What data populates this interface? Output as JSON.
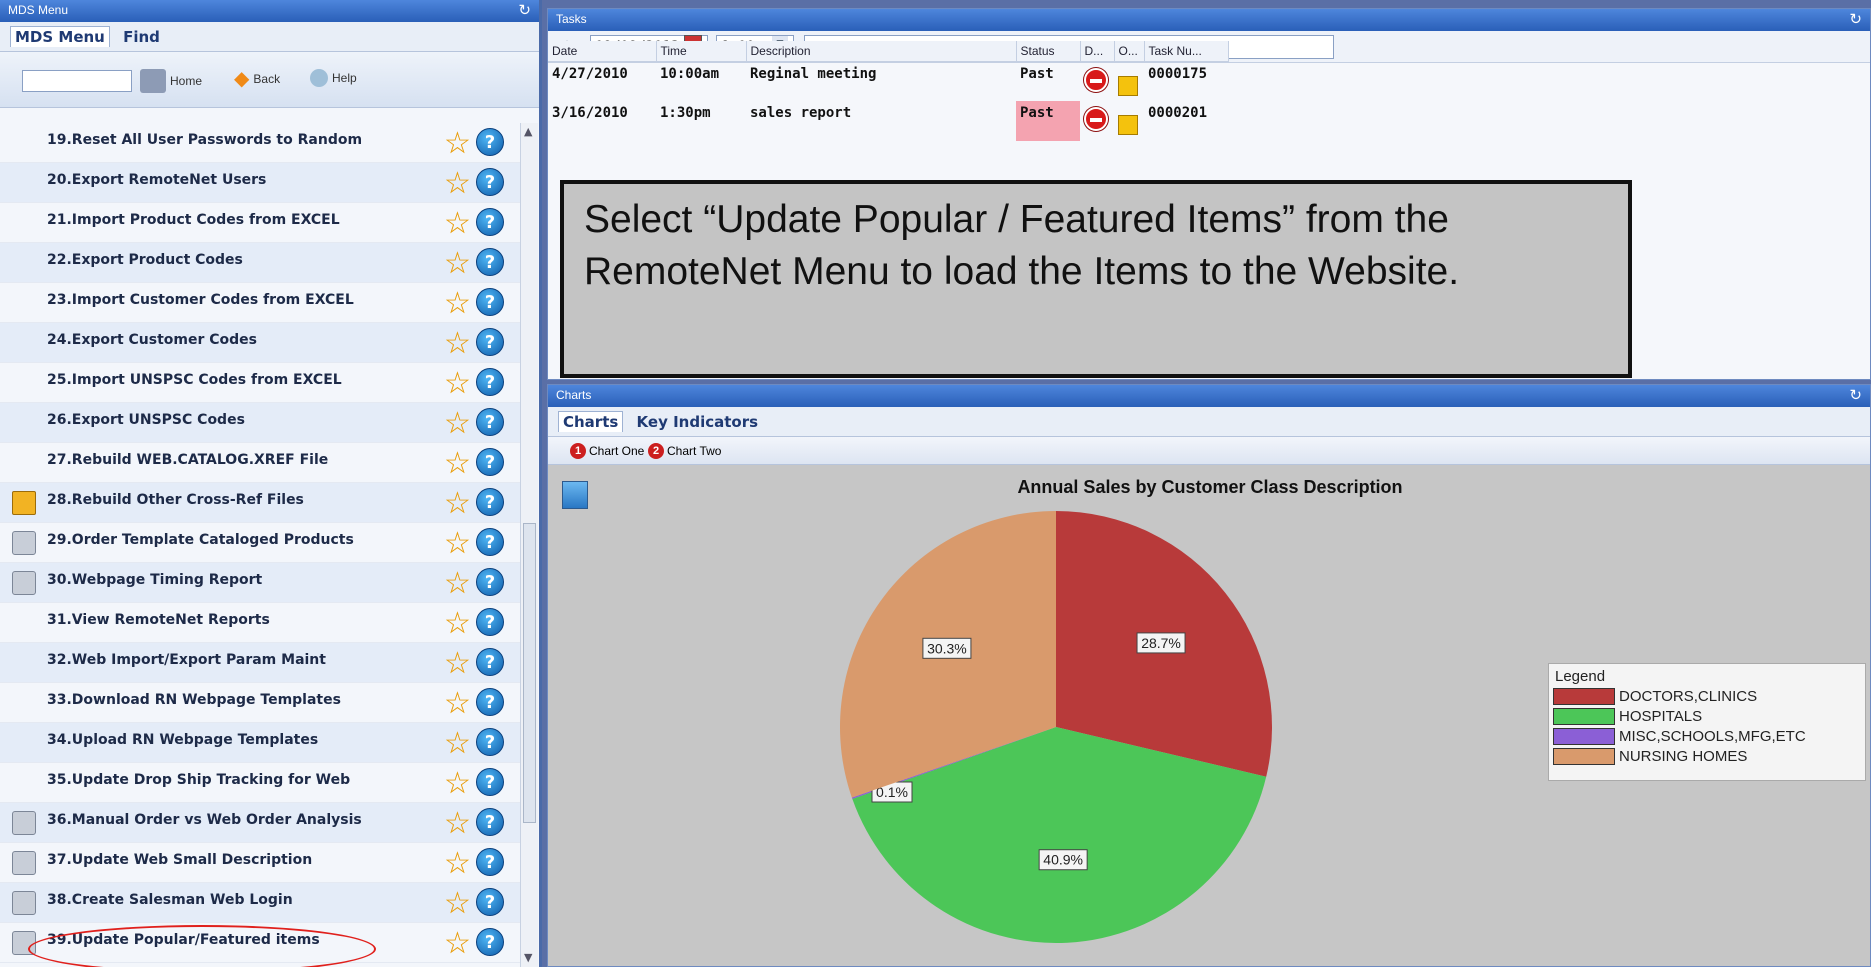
{
  "left_panel": {
    "title": "MDS Menu",
    "tabs": [
      "MDS Menu",
      "Find"
    ],
    "toolbar": {
      "home": "Home",
      "back": "Back",
      "help": "Help"
    },
    "items": [
      {
        "label": "19.Reset All User Passwords to Random",
        "icon": ""
      },
      {
        "label": "20.Export RemoteNet Users",
        "icon": ""
      },
      {
        "label": "21.Import Product Codes from EXCEL",
        "icon": ""
      },
      {
        "label": "22.Export Product Codes",
        "icon": ""
      },
      {
        "label": "23.Import Customer Codes from EXCEL",
        "icon": ""
      },
      {
        "label": "24.Export Customer Codes",
        "icon": ""
      },
      {
        "label": "25.Import UNSPSC Codes from EXCEL",
        "icon": ""
      },
      {
        "label": "26.Export UNSPSC Codes",
        "icon": ""
      },
      {
        "label": "27.Rebuild WEB.CATALOG.XREF File",
        "icon": ""
      },
      {
        "label": "28.Rebuild Other Cross-Ref Files",
        "icon": "folder-icon"
      },
      {
        "label": "29.Order Template Cataloged Products",
        "icon": "printer-icon"
      },
      {
        "label": "30.Webpage Timing Report",
        "icon": "printer-icon"
      },
      {
        "label": "31.View RemoteNet Reports",
        "icon": ""
      },
      {
        "label": "32.Web Import/Export Param Maint",
        "icon": ""
      },
      {
        "label": "33.Download RN Webpage Templates",
        "icon": ""
      },
      {
        "label": "34.Upload RN Webpage Templates",
        "icon": ""
      },
      {
        "label": "35.Update Drop Ship Tracking for Web",
        "icon": ""
      },
      {
        "label": "36.Manual Order vs Web Order Analysis",
        "icon": "printer-icon"
      },
      {
        "label": "37.Update Web Small Description",
        "icon": "printer-icon"
      },
      {
        "label": "38.Create Salesman Web Login",
        "icon": "printer-icon"
      },
      {
        "label": "39.Update Popular/Featured items",
        "icon": "printer-icon"
      }
    ]
  },
  "tasks_panel": {
    "title": "Tasks",
    "date_value": "09/09/2013",
    "time_value": "8:00 am",
    "columns": [
      "Date",
      "Time",
      "Description",
      "Status",
      "D...",
      "O...",
      "Task Nu..."
    ],
    "rows": [
      {
        "date": "4/27/2010",
        "time": "10:00am",
        "description": "Reginal meeting",
        "status": "Past",
        "task": "0000175"
      },
      {
        "date": "3/16/2010",
        "time": "1:30pm",
        "description": "sales report",
        "status": "Past",
        "task": "0000201"
      }
    ]
  },
  "callout": {
    "text": "Select “Update Popular / Featured Items” from the RemoteNet Menu to load the Items to the Website."
  },
  "charts_panel": {
    "title": "Charts",
    "tabs": [
      "Charts",
      "Key Indicators"
    ],
    "buttons": [
      "Chart One",
      "Chart Two"
    ],
    "legend_title": "Legend"
  },
  "chart_data": {
    "type": "pie",
    "title": "Annual Sales by Customer Class Description",
    "categories": [
      "DOCTORS,CLINICS",
      "HOSPITALS",
      "MISC,SCHOOLS,MFG,ETC",
      "NURSING HOMES"
    ],
    "values": [
      28.7,
      40.9,
      0.1,
      30.3
    ],
    "labels": [
      "28.7%",
      "40.9%",
      "0.1%",
      "30.3%"
    ],
    "colors": [
      "#b83a3a",
      "#4cc658",
      "#8b5fd6",
      "#d99a6c"
    ],
    "legend_placement": "right"
  }
}
